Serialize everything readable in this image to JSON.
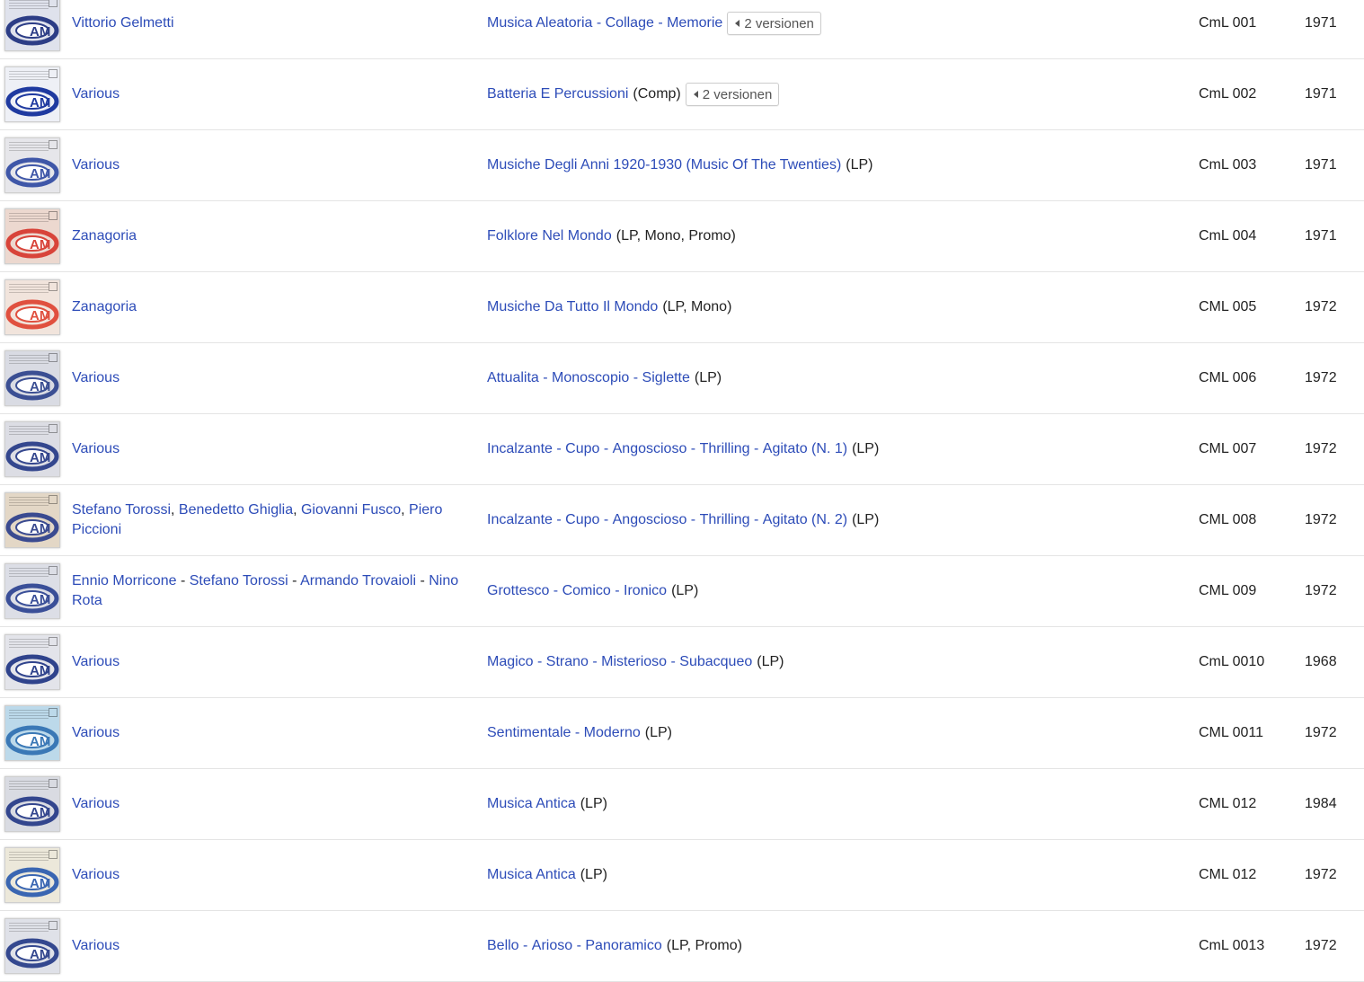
{
  "colors": {
    "link": "#2d4cb8",
    "text": "#222222",
    "row_border": "#e4e4e4"
  },
  "rows": [
    {
      "artists": [
        {
          "name": "Vittorio Gelmetti"
        }
      ],
      "title": "Musica Aleatoria - Collage - Memorie",
      "format": "",
      "versions_label": "2 versionen",
      "catno": "CmL 001",
      "year": "1971",
      "thumb": {
        "icon": "album-cover-icon",
        "logo_text": "AM",
        "bg": "#dfe2ec",
        "accent": "#2c3d86"
      }
    },
    {
      "artists": [
        {
          "name": "Various"
        }
      ],
      "title": "Batteria E Percussioni",
      "format": "(Comp)",
      "versions_label": "2 versionen",
      "catno": "CmL 002",
      "year": "1971",
      "thumb": {
        "icon": "album-cover-icon",
        "logo_text": "AM",
        "bg": "#eef0f6",
        "accent": "#1f3aa0"
      }
    },
    {
      "artists": [
        {
          "name": "Various"
        }
      ],
      "title": "Musiche Degli Anni 1920-1930 (Music Of The Twenties)",
      "format": "(LP)",
      "catno": "CmL 003",
      "year": "1971",
      "thumb": {
        "icon": "album-cover-icon",
        "logo_text": "AM",
        "bg": "#e6e6ea",
        "accent": "#3f57a8"
      }
    },
    {
      "artists": [
        {
          "name": "Zanagoria"
        }
      ],
      "title": "Folklore Nel Mondo",
      "format": "(LP, Mono, Promo)",
      "catno": "CmL 004",
      "year": "1971",
      "thumb": {
        "icon": "album-cover-icon",
        "logo_text": "AM",
        "bg": "#ecd8cf",
        "accent": "#d8443a"
      }
    },
    {
      "artists": [
        {
          "name": "Zanagoria"
        }
      ],
      "title": "Musiche Da Tutto Il Mondo",
      "format": "(LP, Mono)",
      "catno": "CML 005",
      "year": "1972",
      "thumb": {
        "icon": "album-cover-icon",
        "logo_text": "AM",
        "bg": "#f1e4dc",
        "accent": "#e0503f"
      }
    },
    {
      "artists": [
        {
          "name": "Various"
        }
      ],
      "title_parts": [
        "Attualita",
        "Monoscopio",
        "Siglette"
      ],
      "format": "(LP)",
      "catno": "CML 006",
      "year": "1972",
      "thumb": {
        "icon": "album-cover-icon",
        "logo_text": "AM",
        "bg": "#d9dbe3",
        "accent": "#3b4f93"
      }
    },
    {
      "artists": [
        {
          "name": "Various"
        }
      ],
      "title_parts": [
        "Incalzante",
        "Cupo",
        "Angoscioso",
        "Thrilling",
        "Agitato (N. 1)"
      ],
      "format": "(LP)",
      "catno": "CML 007",
      "year": "1972",
      "thumb": {
        "icon": "album-cover-icon",
        "logo_text": "AM",
        "bg": "#dcdde4",
        "accent": "#34478e"
      }
    },
    {
      "artists": [
        {
          "name": "Stefano Torossi",
          "sep": ", "
        },
        {
          "name": "Benedetto Ghiglia",
          "sep": ", "
        },
        {
          "name": "Giovanni Fusco",
          "sep": ", "
        },
        {
          "name": "Piero Piccioni"
        }
      ],
      "title_parts": [
        "Incalzante",
        "Cupo",
        "Angoscioso",
        "Thrilling",
        "Agitato (N. 2)"
      ],
      "format": "(LP)",
      "catno": "CML 008",
      "year": "1972",
      "thumb": {
        "icon": "album-cover-icon",
        "logo_text": "AM",
        "bg": "#e3d7c6",
        "accent": "#3a4a90"
      }
    },
    {
      "artists": [
        {
          "name": "Ennio Morricone",
          "sep": " - "
        },
        {
          "name": "Stefano Torossi",
          "sep": " - "
        },
        {
          "name": "Armando Trovaioli",
          "sep": " - "
        },
        {
          "name": "Nino Rota"
        }
      ],
      "title_parts": [
        "Grottesco",
        "Comico",
        "Ironico"
      ],
      "format": "(LP)",
      "catno": "CML 009",
      "year": "1972",
      "thumb": {
        "icon": "album-cover-icon",
        "logo_text": "AM",
        "bg": "#dcdee6",
        "accent": "#3a4f98"
      }
    },
    {
      "artists": [
        {
          "name": "Various"
        }
      ],
      "title_parts": [
        "Magico",
        "Strano",
        "Misterioso",
        "Subacqueo"
      ],
      "format": "(LP)",
      "catno": "CmL 0010",
      "year": "1968",
      "thumb": {
        "icon": "album-cover-icon",
        "logo_text": "AM",
        "bg": "#e3e4ea",
        "accent": "#2f438c"
      }
    },
    {
      "artists": [
        {
          "name": "Various"
        }
      ],
      "title_parts": [
        "Sentimentale",
        "Moderno"
      ],
      "format": "(LP)",
      "catno": "CML 0011",
      "year": "1972",
      "thumb": {
        "icon": "album-cover-icon",
        "logo_text": "AM",
        "bg": "#bcd9ea",
        "accent": "#3a78b6"
      }
    },
    {
      "artists": [
        {
          "name": "Various"
        }
      ],
      "title": "Musica Antica",
      "format": "(LP)",
      "catno": "CML 012",
      "year": "1984",
      "thumb": {
        "icon": "album-cover-icon",
        "logo_text": "AM",
        "bg": "#d9dbe2",
        "accent": "#33468e"
      }
    },
    {
      "artists": [
        {
          "name": "Various"
        }
      ],
      "title": "Musica Antica",
      "format": "(LP)",
      "catno": "CML 012",
      "year": "1972",
      "thumb": {
        "icon": "album-cover-icon",
        "logo_text": "AM",
        "bg": "#ece8da",
        "accent": "#3a66b2"
      }
    },
    {
      "artists": [
        {
          "name": "Various"
        }
      ],
      "title_parts": [
        "Bello",
        "Arioso",
        "Panoramico"
      ],
      "format": "(LP, Promo)",
      "catno": "CmL 0013",
      "year": "1972",
      "thumb": {
        "icon": "album-cover-icon",
        "logo_text": "AM",
        "bg": "#dfe1e8",
        "accent": "#34488f"
      }
    }
  ]
}
